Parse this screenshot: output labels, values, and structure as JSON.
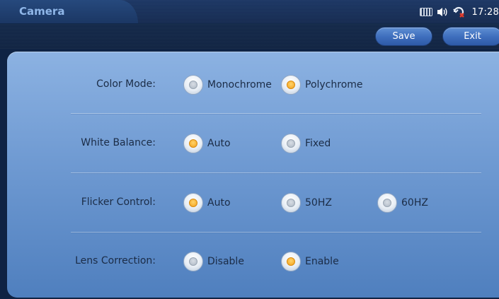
{
  "window": {
    "title": "Camera"
  },
  "status_bar": {
    "icons": [
      "keyboard-icon",
      "volume-icon",
      "network-disconnected-icon"
    ],
    "time": "17:28"
  },
  "toolbar": {
    "save_label": "Save",
    "exit_label": "Exit"
  },
  "settings": [
    {
      "label": "Color Mode:",
      "options": [
        {
          "label": "Monochrome",
          "selected": false
        },
        {
          "label": "Polychrome",
          "selected": true
        }
      ]
    },
    {
      "label": "White Balance:",
      "options": [
        {
          "label": "Auto",
          "selected": true
        },
        {
          "label": "Fixed",
          "selected": false
        }
      ]
    },
    {
      "label": "Flicker Control:",
      "options": [
        {
          "label": "Auto",
          "selected": true
        },
        {
          "label": "50HZ",
          "selected": false
        },
        {
          "label": "60HZ",
          "selected": false
        }
      ]
    },
    {
      "label": "Lens Correction:",
      "options": [
        {
          "label": "Disable",
          "selected": false
        },
        {
          "label": "Enable",
          "selected": true
        }
      ]
    }
  ],
  "colors": {
    "accent_selected": "#f3a21b",
    "panel": "#6f9ad2",
    "title_text": "#8fb6e8"
  }
}
